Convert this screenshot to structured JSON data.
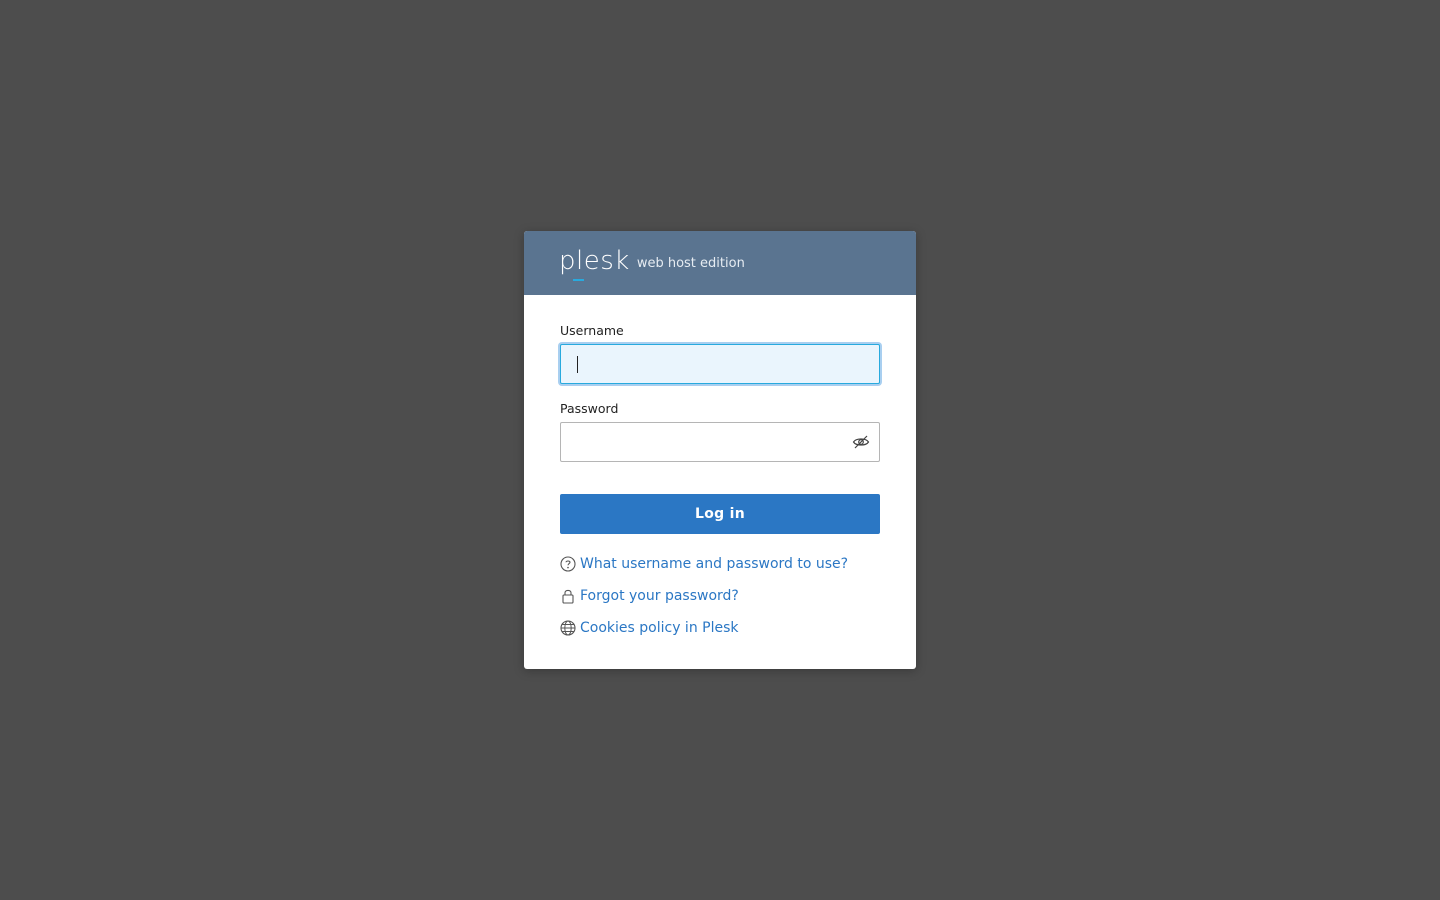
{
  "header": {
    "logo_text": "plesk",
    "edition": "web host edition"
  },
  "form": {
    "username_label": "Username",
    "username_value": "",
    "password_label": "Password",
    "password_value": "",
    "login_label": "Log in"
  },
  "links": {
    "help": "What username and password to use?",
    "forgot": "Forgot your password?",
    "cookies": "Cookies policy in Plesk"
  },
  "colors": {
    "background": "#4d4d4d",
    "header": "#5a7490",
    "accent": "#2b77c4",
    "logo_underline": "#28aade"
  },
  "icons": {
    "password_toggle": "eye-slash-icon",
    "help": "question-circle-icon",
    "forgot": "lock-icon",
    "cookies": "globe-icon"
  }
}
